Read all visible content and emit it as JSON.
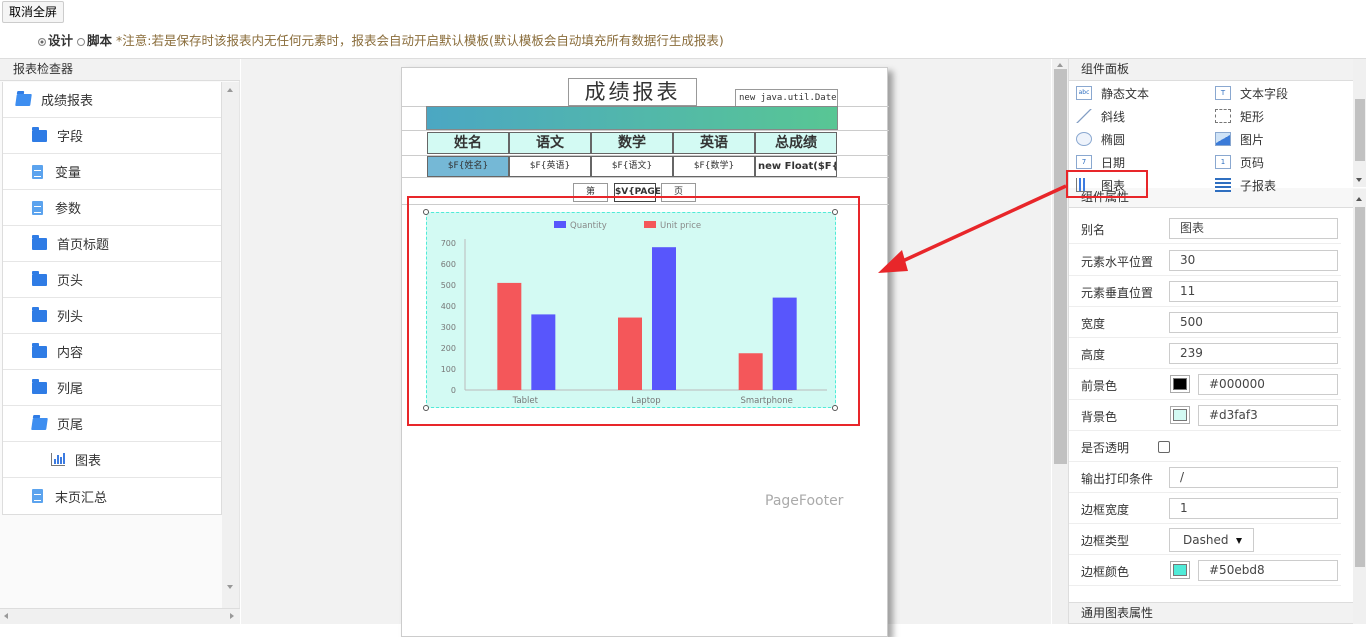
{
  "toolbar": {
    "exit_fullscreen": "取消全屏",
    "design_label": "设计",
    "script_label": "脚本",
    "notice": "*注意:若是保存时该报表内无任何元素时，报表会自动开启默认模板(默认模板会自动填充所有数据行生成报表)"
  },
  "inspector": {
    "title": "报表检查器",
    "items": [
      {
        "label": "成绩报表",
        "icon": "folder-open-icon"
      },
      {
        "label": "字段",
        "icon": "folder-icon"
      },
      {
        "label": "变量",
        "icon": "file-icon"
      },
      {
        "label": "参数",
        "icon": "file-icon"
      },
      {
        "label": "首页标题",
        "icon": "folder-icon"
      },
      {
        "label": "页头",
        "icon": "folder-icon"
      },
      {
        "label": "列头",
        "icon": "folder-icon"
      },
      {
        "label": "内容",
        "icon": "folder-icon"
      },
      {
        "label": "列尾",
        "icon": "folder-icon"
      },
      {
        "label": "页尾",
        "icon": "folder-open-icon"
      },
      {
        "label": "图表",
        "icon": "chart-icon"
      },
      {
        "label": "末页汇总",
        "icon": "file-icon"
      }
    ]
  },
  "report": {
    "title": "成绩报表",
    "date_field": "new java.util.Date()",
    "headers": [
      "姓名",
      "语文",
      "数学",
      "英语",
      "总成绩"
    ],
    "cells": [
      "$F{姓名}",
      "$F{英语}",
      "$F{语文}",
      "$F{数学}",
      "new Float($F{语"
    ],
    "page_parts": [
      "第",
      "$V{PAGE",
      "页"
    ],
    "footer_label": "PageFooter"
  },
  "chart_data": {
    "type": "bar",
    "categories": [
      "Tablet",
      "Laptop",
      "Smartphone"
    ],
    "series": [
      {
        "name": "Quantity",
        "values": [
          360,
          680,
          440
        ],
        "color": "#5856fc"
      },
      {
        "name": "Unit price",
        "values": [
          510,
          345,
          175
        ],
        "color": "#f4575a"
      }
    ],
    "yticks": [
      "0",
      "100",
      "200",
      "300",
      "400",
      "500",
      "600",
      "700"
    ],
    "ylim": [
      0,
      700
    ],
    "legend": "top-center",
    "background": "#d3faf3"
  },
  "components": {
    "title": "组件面板",
    "items": [
      {
        "label": "静态文本",
        "icon": "static-text-icon",
        "glyph": "abc"
      },
      {
        "label": "文本字段",
        "icon": "text-field-icon",
        "glyph": "T"
      },
      {
        "label": "斜线",
        "icon": "line-icon",
        "glyph": ""
      },
      {
        "label": "矩形",
        "icon": "rectangle-icon",
        "glyph": ""
      },
      {
        "label": "椭圆",
        "icon": "ellipse-icon",
        "glyph": ""
      },
      {
        "label": "图片",
        "icon": "image-icon",
        "glyph": ""
      },
      {
        "label": "日期",
        "icon": "date-icon",
        "glyph": "7"
      },
      {
        "label": "页码",
        "icon": "page-number-icon",
        "glyph": "1"
      },
      {
        "label": "图表",
        "icon": "chart-icon",
        "glyph": ""
      },
      {
        "label": "子报表",
        "icon": "subreport-icon",
        "glyph": ""
      }
    ]
  },
  "properties": {
    "title": "组件属性",
    "alias_label": "别名",
    "alias": "图表",
    "x_label": "元素水平位置",
    "x": "30",
    "y_label": "元素垂直位置",
    "y": "11",
    "width_label": "宽度",
    "width": "500",
    "height_label": "高度",
    "height": "239",
    "fg_label": "前景色",
    "fg": "#000000",
    "bg_label": "背景色",
    "bg": "#d3faf3",
    "transparent_label": "是否透明",
    "print_label": "输出打印条件",
    "print": "/",
    "border_width_label": "边框宽度",
    "border_width": "1",
    "border_type_label": "边框类型",
    "border_type": "Dashed",
    "border_color_label": "边框颜色",
    "border_color": "#50ebd8",
    "general_title": "通用图表属性"
  },
  "colors": {
    "highlight": "#e8262a",
    "folder": "#2f7ce5"
  }
}
